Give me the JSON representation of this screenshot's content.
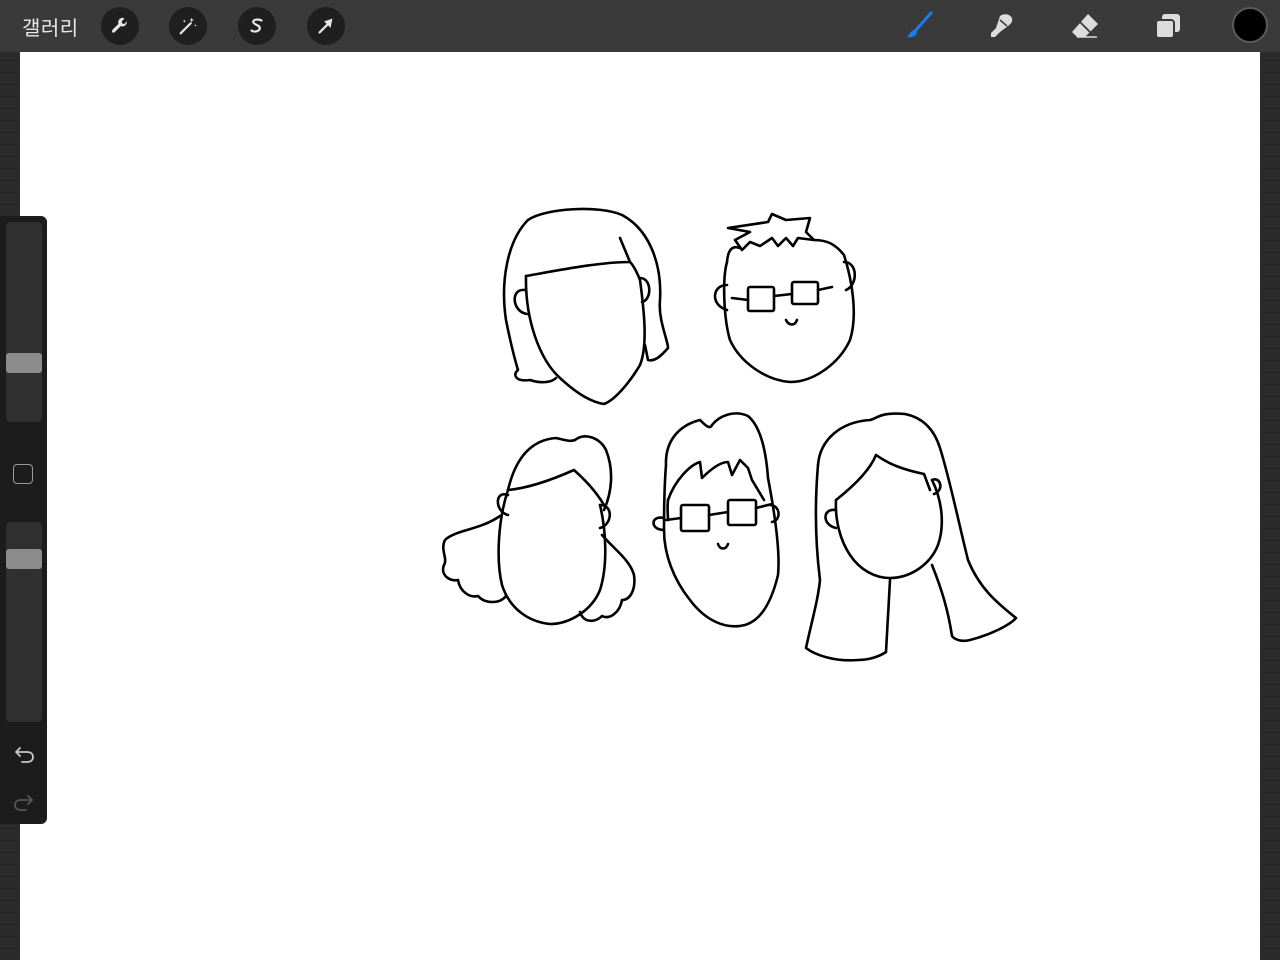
{
  "toolbar": {
    "gallery_label": "갤러리",
    "left_tools": [
      {
        "name": "actions",
        "icon": "wrench-icon"
      },
      {
        "name": "adjustments",
        "icon": "magic-wand-icon"
      },
      {
        "name": "selection",
        "icon": "selection-s-icon"
      },
      {
        "name": "transform",
        "icon": "arrow-cursor-icon"
      }
    ],
    "right_tools": [
      {
        "name": "brush",
        "icon": "brush-icon",
        "active": true
      },
      {
        "name": "smudge",
        "icon": "smudge-icon",
        "active": false
      },
      {
        "name": "eraser",
        "icon": "eraser-icon",
        "active": false
      },
      {
        "name": "layers",
        "icon": "layers-icon",
        "active": false
      }
    ],
    "current_color": "#000000",
    "active_color": "#1a7cf0"
  },
  "sidebar": {
    "brush_size_level": 0.27,
    "opacity_level": 0.85,
    "undo_icon": "undo-icon",
    "redo_icon": "redo-icon"
  },
  "canvas": {
    "background": "#ffffff",
    "stroke_color": "#000000",
    "drawing": "five-faces-sketch"
  }
}
